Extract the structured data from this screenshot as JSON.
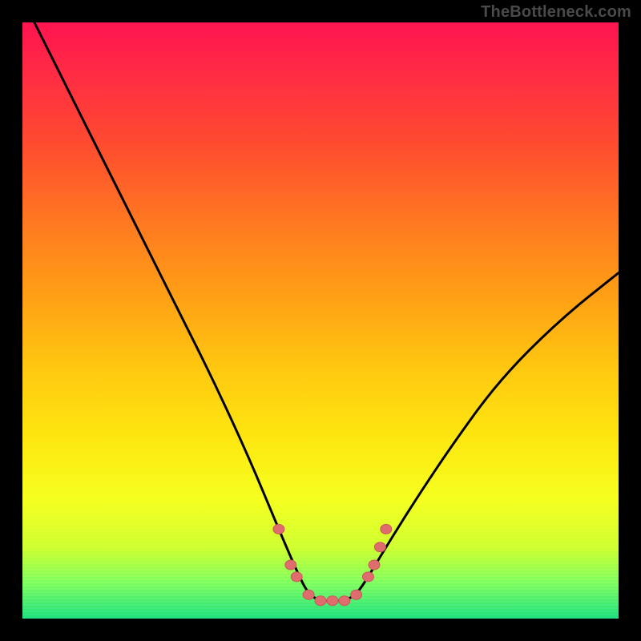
{
  "watermark": "TheBottleneck.com",
  "colors": {
    "frame": "#000000",
    "curve_stroke": "#000000",
    "marker_fill": "#e06d6d",
    "marker_stroke": "#c85a5a"
  },
  "chart_data": {
    "type": "line",
    "title": "",
    "xlabel": "",
    "ylabel": "",
    "xlim": [
      0,
      100
    ],
    "ylim": [
      0,
      100
    ],
    "grid": false,
    "legend": false,
    "note": "Background is a vertical rainbow gradient (red→orange→yellow→green). Curve is a black asymmetric V / bottleneck shape with salmon markers near the trough.",
    "series": [
      {
        "name": "bottleneck-curve",
        "x": [
          2,
          8,
          14,
          20,
          26,
          32,
          38,
          43,
          46,
          48,
          50,
          52,
          54,
          56,
          58,
          61,
          66,
          72,
          80,
          90,
          100
        ],
        "y": [
          100,
          88,
          76,
          64,
          52,
          40,
          27,
          15,
          8,
          4,
          3,
          3,
          3,
          4,
          7,
          12,
          20,
          29,
          40,
          50,
          58
        ]
      }
    ],
    "markers": [
      {
        "x": 43,
        "y": 15
      },
      {
        "x": 45,
        "y": 9
      },
      {
        "x": 46,
        "y": 7
      },
      {
        "x": 48,
        "y": 4
      },
      {
        "x": 50,
        "y": 3
      },
      {
        "x": 52,
        "y": 3
      },
      {
        "x": 54,
        "y": 3
      },
      {
        "x": 56,
        "y": 4
      },
      {
        "x": 58,
        "y": 7
      },
      {
        "x": 59,
        "y": 9
      },
      {
        "x": 60,
        "y": 12
      },
      {
        "x": 61,
        "y": 15
      }
    ]
  }
}
